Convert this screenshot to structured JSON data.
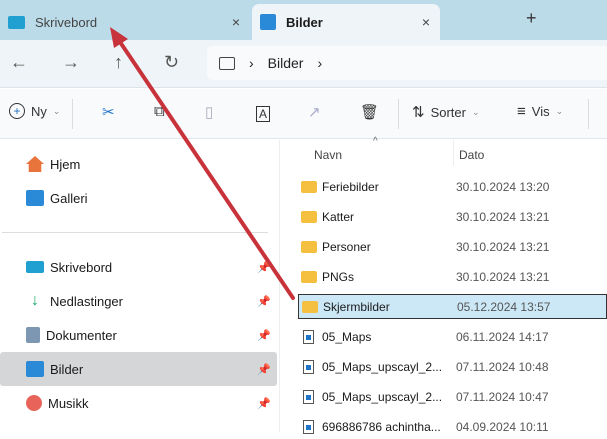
{
  "tabs": [
    {
      "label": "Skrivebord",
      "close": "×"
    },
    {
      "label": "Bilder",
      "close": "×"
    }
  ],
  "new_tab": "+",
  "nav": {
    "back": "←",
    "forward": "→",
    "up": "↑",
    "refresh": "↻",
    "breadcrumb": [
      "Bilder"
    ],
    "sep": "›"
  },
  "toolbar": {
    "new": "Ny",
    "sort": "Sorter",
    "view": "Vis"
  },
  "sidebar": {
    "items": [
      {
        "label": "Hjem",
        "color": "#e8743b"
      },
      {
        "label": "Galleri",
        "color": "#2a8ad8"
      },
      {
        "label": "Skrivebord",
        "color": "#1fa0d0",
        "pin": true
      },
      {
        "label": "Nedlastinger",
        "color": "#1aa86a",
        "pin": true
      },
      {
        "label": "Dokumenter",
        "color": "#7d97b3",
        "pin": true
      },
      {
        "label": "Bilder",
        "color": "#2a8ad8",
        "pin": true,
        "selected": true
      },
      {
        "label": "Musikk",
        "color": "#e8645a",
        "pin": true
      }
    ]
  },
  "columns": {
    "name": "Navn",
    "date": "Dato"
  },
  "files": [
    {
      "name": "Feriebilder",
      "date": "30.10.2024 13:20",
      "type": "folder"
    },
    {
      "name": "Katter",
      "date": "30.10.2024 13:21",
      "type": "folder"
    },
    {
      "name": "Personer",
      "date": "30.10.2024 13:21",
      "type": "folder"
    },
    {
      "name": "PNGs",
      "date": "30.10.2024 13:21",
      "type": "folder"
    },
    {
      "name": "Skjermbilder",
      "date": "05.12.2024 13:57",
      "type": "folder",
      "selected": true
    },
    {
      "name": "05_Maps",
      "date": "06.11.2024 14:17",
      "type": "file"
    },
    {
      "name": "05_Maps_upscayl_2...",
      "date": "07.11.2024 10:48",
      "type": "file"
    },
    {
      "name": "05_Maps_upscayl_2...",
      "date": "07.11.2024 10:47",
      "type": "file"
    },
    {
      "name": "696886786 achintha...",
      "date": "04.09.2024 10:11",
      "type": "file"
    }
  ],
  "annotation_color": "#c8323a"
}
